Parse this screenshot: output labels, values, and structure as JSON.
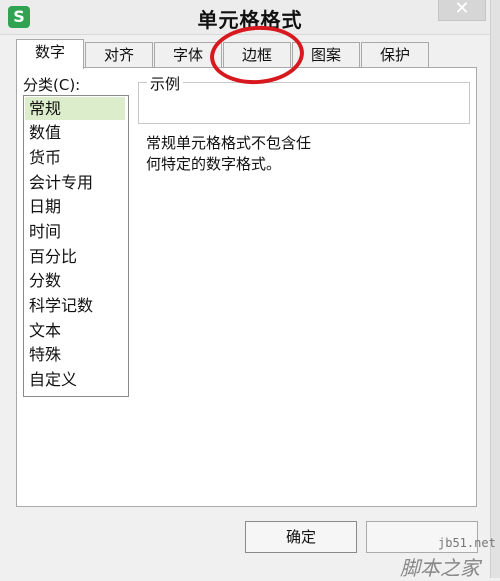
{
  "window": {
    "app_icon": "S",
    "title": "单元格格式",
    "close_glyph": "✕"
  },
  "tabs": [
    {
      "label": "数字",
      "active": true
    },
    {
      "label": "对齐",
      "active": false
    },
    {
      "label": "字体",
      "active": false
    },
    {
      "label": "边框",
      "active": false
    },
    {
      "label": "图案",
      "active": false
    },
    {
      "label": "保护",
      "active": false
    }
  ],
  "category": {
    "label": "分类(C):",
    "selected": "常规",
    "items": [
      "常规",
      "数值",
      "货币",
      "会计专用",
      "日期",
      "时间",
      "百分比",
      "分数",
      "科学记数",
      "文本",
      "特殊",
      "自定义"
    ]
  },
  "sample": {
    "legend": "示例",
    "value": ""
  },
  "description": {
    "line1": "常规单元格格式不包含任",
    "line2": "何特定的数字格式。"
  },
  "buttons": {
    "ok_label": "确定",
    "cancel_label": ""
  },
  "annotation": {
    "color": "#d7191f",
    "highlighted_tab": "边框"
  },
  "watermark": {
    "url": "jb51.net",
    "text": "脚本之家"
  }
}
